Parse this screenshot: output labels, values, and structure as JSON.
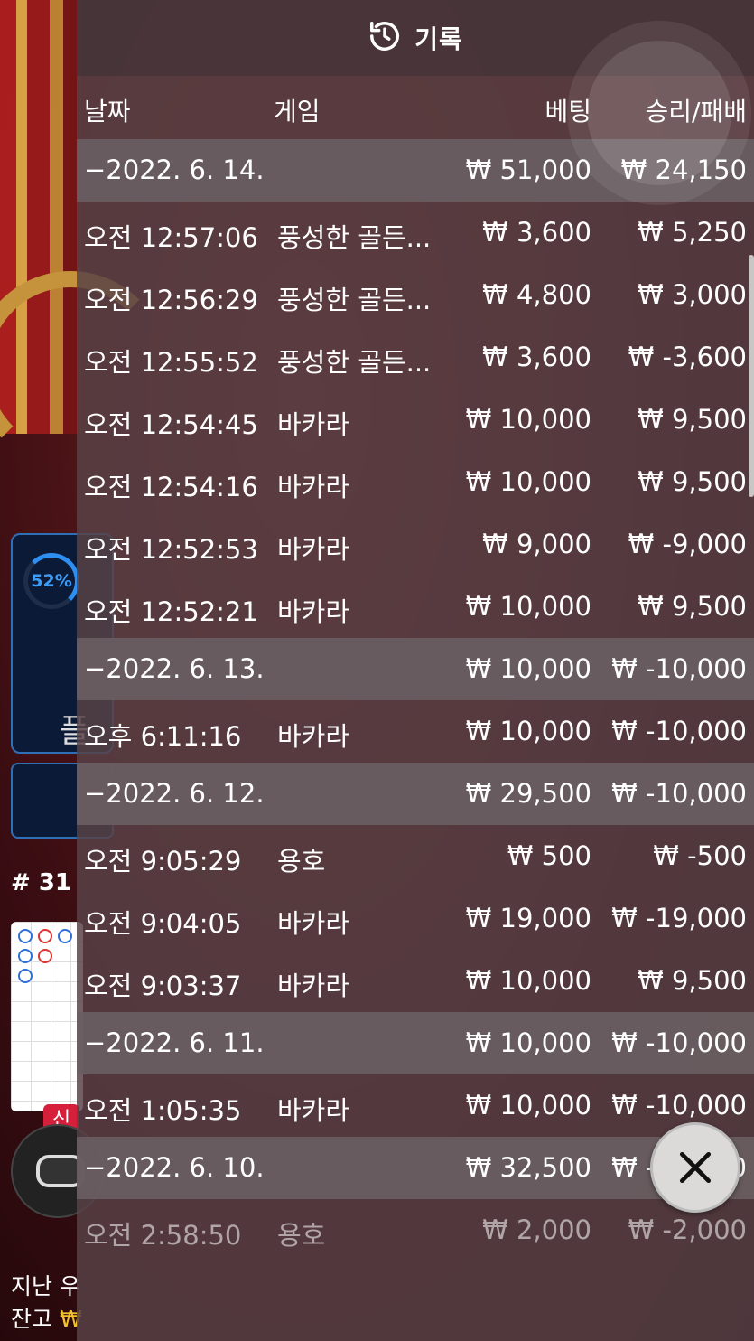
{
  "panel": {
    "title": "기록"
  },
  "columns": {
    "date": "날짜",
    "game": "게임",
    "bet": "베팅",
    "winloss": "승리/패배"
  },
  "rows": [
    {
      "type": "date",
      "date": "−2022. 6. 14.",
      "bet": "₩ 51,000",
      "winloss": "₩ 24,150"
    },
    {
      "type": "entry",
      "time": "오전 12:57:06",
      "game": "풍성한 골든...",
      "bet": "₩ 3,600",
      "winloss": "₩ 5,250"
    },
    {
      "type": "entry",
      "time": "오전 12:56:29",
      "game": "풍성한 골든...",
      "bet": "₩ 4,800",
      "winloss": "₩ 3,000"
    },
    {
      "type": "entry",
      "time": "오전 12:55:52",
      "game": "풍성한 골든...",
      "bet": "₩ 3,600",
      "winloss": "₩ -3,600"
    },
    {
      "type": "entry",
      "time": "오전 12:54:45",
      "game": "바카라",
      "bet": "₩ 10,000",
      "winloss": "₩ 9,500"
    },
    {
      "type": "entry",
      "time": "오전 12:54:16",
      "game": "바카라",
      "bet": "₩ 10,000",
      "winloss": "₩ 9,500"
    },
    {
      "type": "entry",
      "time": "오전 12:52:53",
      "game": "바카라",
      "bet": "₩ 9,000",
      "winloss": "₩ -9,000"
    },
    {
      "type": "entry",
      "time": "오전 12:52:21",
      "game": "바카라",
      "bet": "₩ 10,000",
      "winloss": "₩ 9,500"
    },
    {
      "type": "date",
      "date": "−2022. 6. 13.",
      "bet": "₩ 10,000",
      "winloss": "₩ -10,000"
    },
    {
      "type": "entry",
      "time": "오후 6:11:16",
      "game": "바카라",
      "bet": "₩ 10,000",
      "winloss": "₩ -10,000"
    },
    {
      "type": "date",
      "date": "−2022. 6. 12.",
      "bet": "₩ 29,500",
      "winloss": "₩ -10,000"
    },
    {
      "type": "entry",
      "time": "오전 9:05:29",
      "game": "용호",
      "bet": "₩ 500",
      "winloss": "₩ -500"
    },
    {
      "type": "entry",
      "time": "오전 9:04:05",
      "game": "바카라",
      "bet": "₩ 19,000",
      "winloss": "₩ -19,000"
    },
    {
      "type": "entry",
      "time": "오전 9:03:37",
      "game": "바카라",
      "bet": "₩ 10,000",
      "winloss": "₩ 9,500"
    },
    {
      "type": "date",
      "date": "−2022. 6. 11.",
      "bet": "₩ 10,000",
      "winloss": "₩ -10,000"
    },
    {
      "type": "entry",
      "time": "오전 1:05:35",
      "game": "바카라",
      "bet": "₩ 10,000",
      "winloss": "₩ -10,000"
    },
    {
      "type": "date",
      "date": "−2022. 6. 10.",
      "bet": "₩ 32,500",
      "winloss": "₩ -10,000"
    },
    {
      "type": "entry",
      "time": "오전 2:58:50",
      "game": "용호",
      "bet": "₩ 2,000",
      "winloss": "₩ -2,000"
    }
  ],
  "background": {
    "percent": "52%",
    "player_label": "플",
    "round": "# 31",
    "new_tag": "신",
    "footer_line1": "지난 우",
    "footer_line2_label": "잔고",
    "footer_line2_value": "₩"
  }
}
